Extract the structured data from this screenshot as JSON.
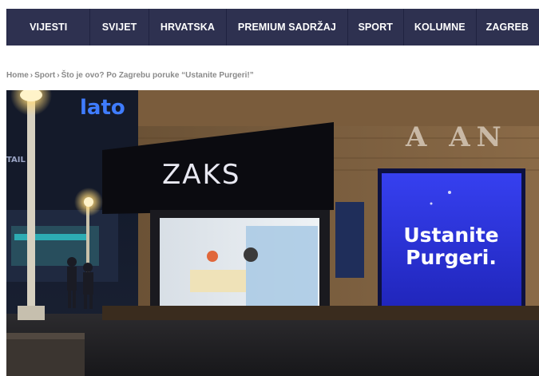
{
  "nav": {
    "items": [
      {
        "label": "VIJESTI"
      },
      {
        "label": "SVIJET"
      },
      {
        "label": "HRVATSKA"
      },
      {
        "label": "PREMIUM SADRŽAJ"
      },
      {
        "label": "SPORT"
      },
      {
        "label": "KOLUMNE"
      },
      {
        "label": "ZAGREB"
      }
    ]
  },
  "breadcrumb": {
    "home": "Home",
    "separator": "›",
    "section": "Sport",
    "current": "Što je ovo? Po Zagrebu poruke “Ustanite Purgeri!”"
  },
  "photo": {
    "store_sign": "ZAKS",
    "top_sign": "lato",
    "side_sign": "TAIL",
    "building_letters": "A AN",
    "billboard_line1": "Ustanite",
    "billboard_line2": "Purgeri."
  },
  "colors": {
    "nav_bg": "#2e3150",
    "billboard": "#2a2fd6",
    "breadcrumb_text": "#8a8a8a"
  }
}
